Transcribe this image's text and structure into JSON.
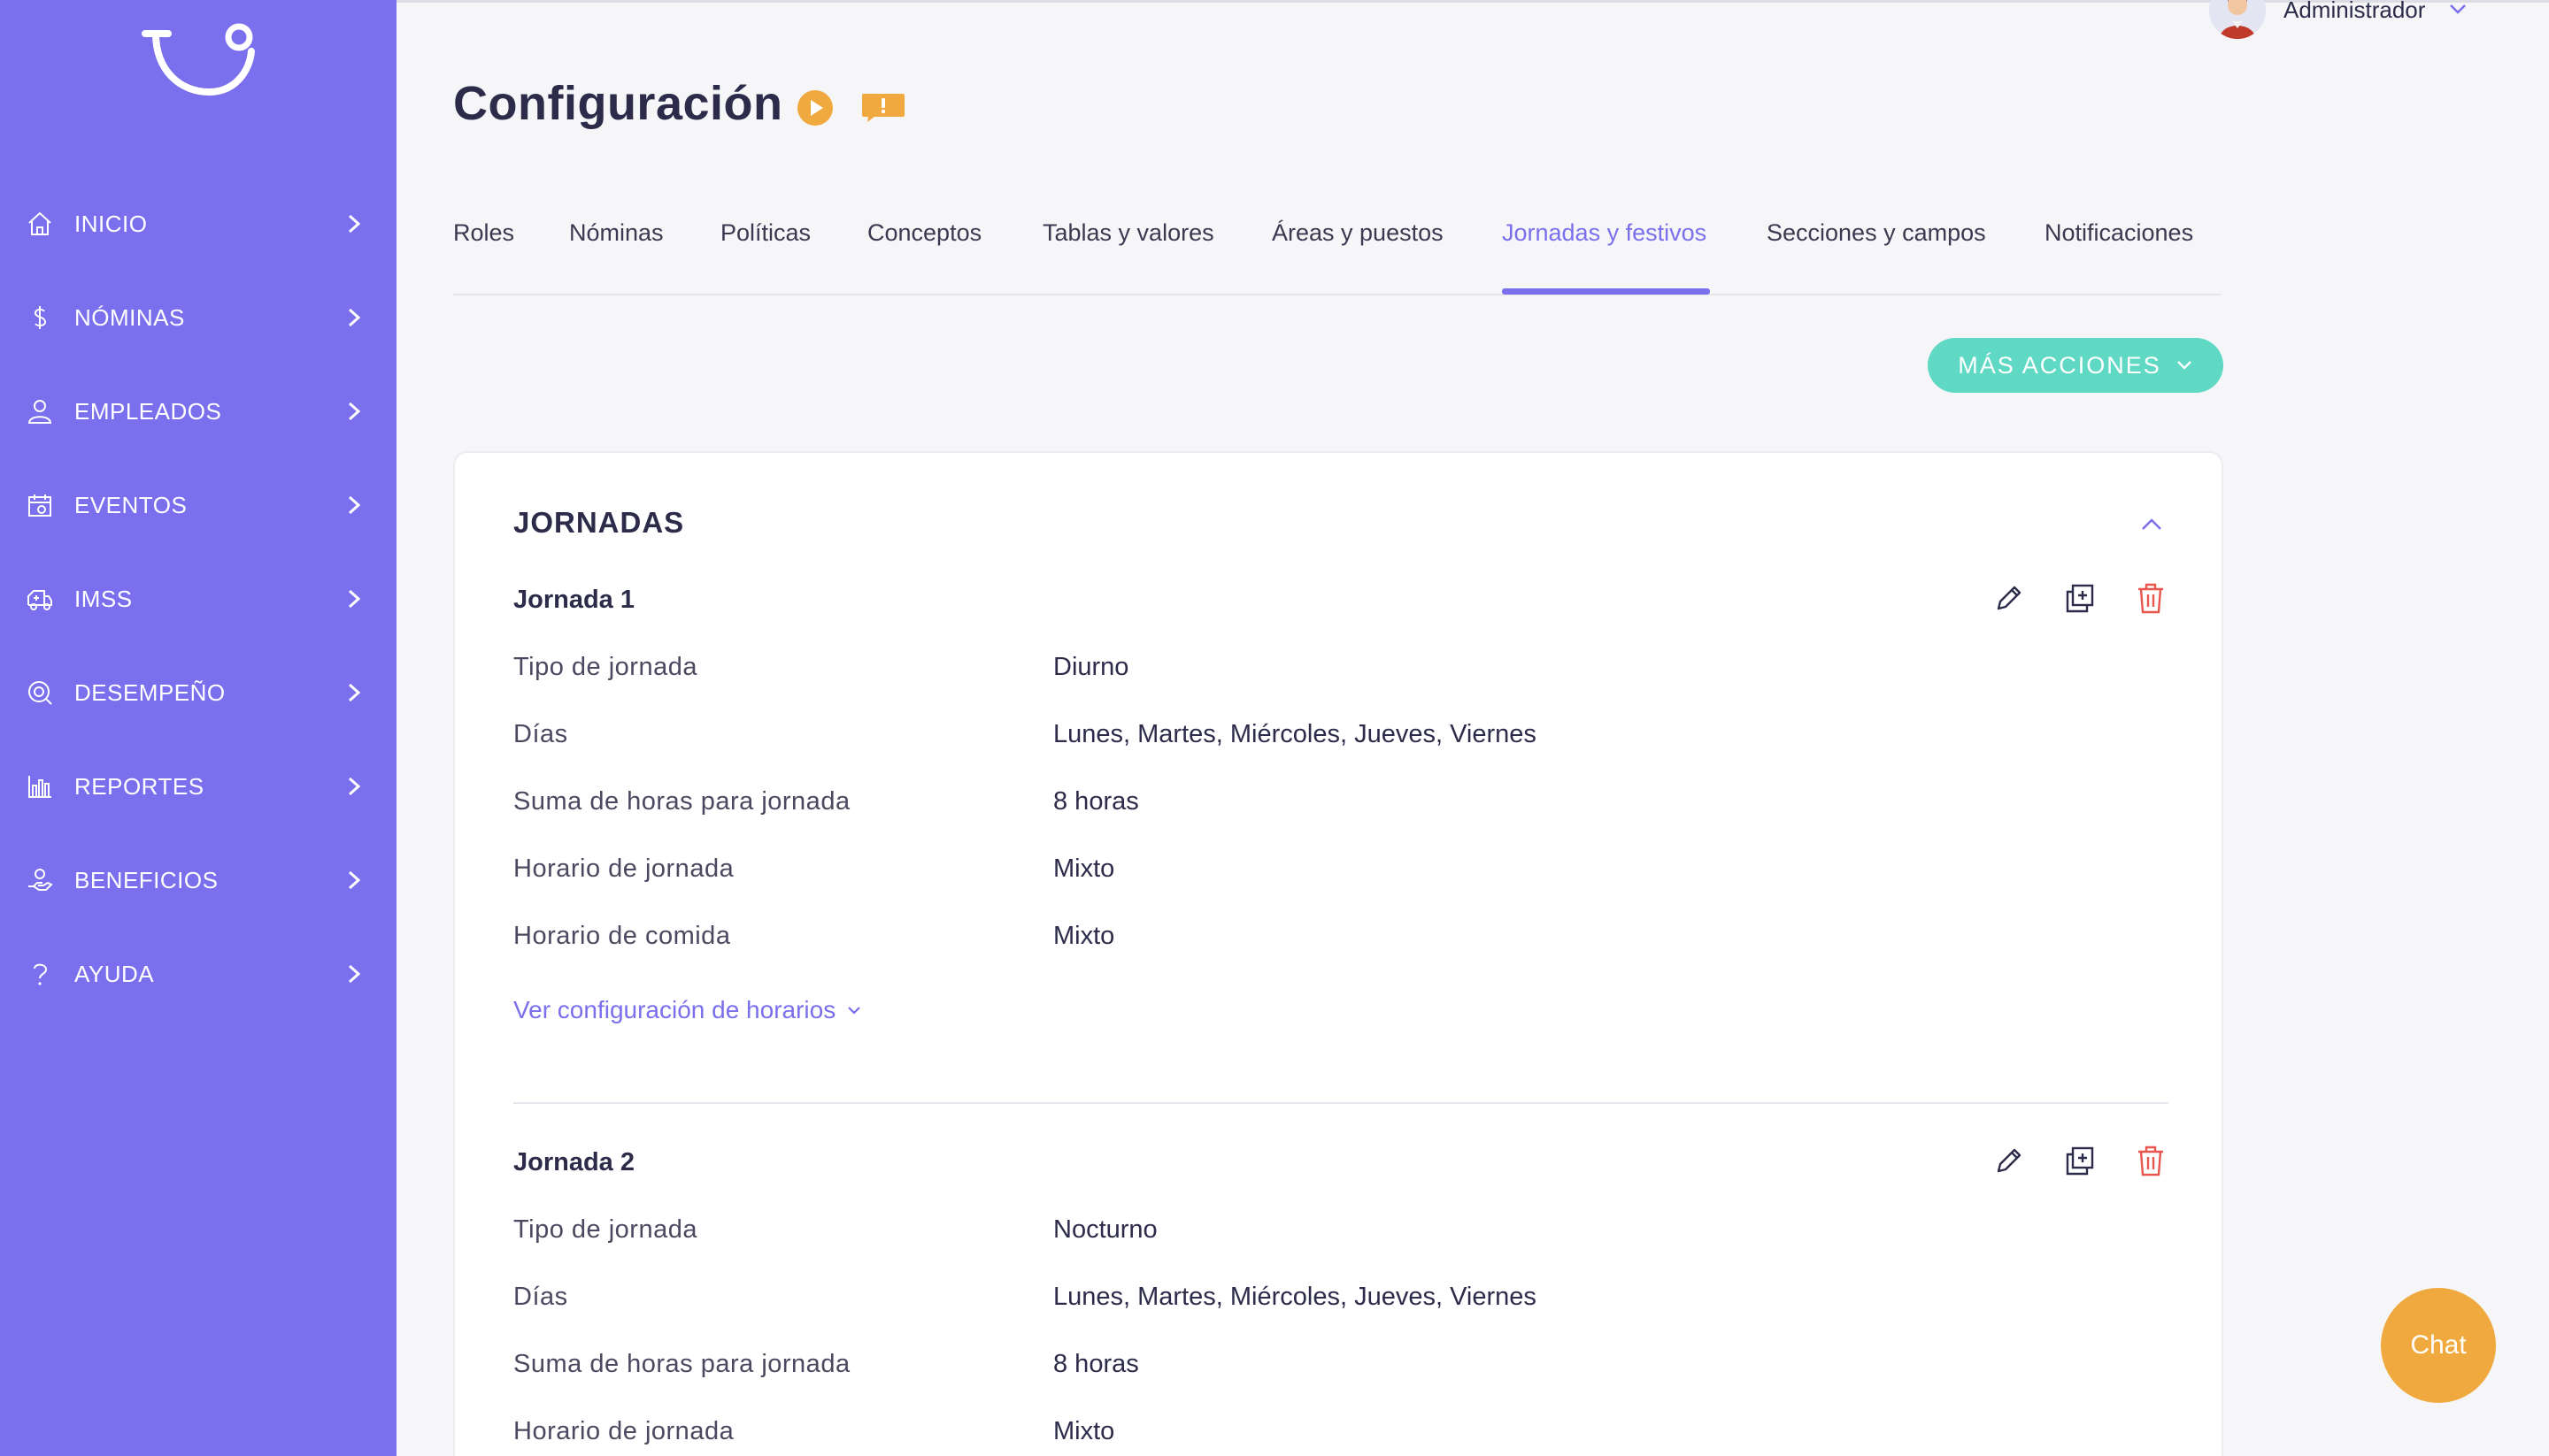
{
  "sidebar": {
    "logo_icon": "brand-logo-icon",
    "items": [
      {
        "label": "INICIO",
        "icon": "home-icon"
      },
      {
        "label": "NÓMINAS",
        "icon": "dollar-icon"
      },
      {
        "label": "EMPLEADOS",
        "icon": "user-icon"
      },
      {
        "label": "EVENTOS",
        "icon": "calendar-icon"
      },
      {
        "label": "IMSS",
        "icon": "ambulance-icon"
      },
      {
        "label": "DESEMPEÑO",
        "icon": "target-icon"
      },
      {
        "label": "REPORTES",
        "icon": "bar-chart-icon"
      },
      {
        "label": "BENEFICIOS",
        "icon": "hand-gift-icon"
      },
      {
        "label": "AYUDA",
        "icon": "question-icon"
      }
    ]
  },
  "header": {
    "user_name": "Administrador",
    "title": "Configuración"
  },
  "tabs": [
    {
      "label": "Roles",
      "active": false
    },
    {
      "label": "Nóminas",
      "active": false
    },
    {
      "label": "Políticas",
      "active": false
    },
    {
      "label": "Conceptos",
      "active": false
    },
    {
      "label": "Tablas y valores",
      "active": false
    },
    {
      "label": "Áreas y puestos",
      "active": false
    },
    {
      "label": "Jornadas y festivos",
      "active": true
    },
    {
      "label": "Secciones y campos",
      "active": false
    },
    {
      "label": "Notificaciones",
      "active": false
    }
  ],
  "actions": {
    "more_label": "MÁS ACCIONES"
  },
  "card": {
    "title": "JORNADAS",
    "jornadas": [
      {
        "title": "Jornada 1",
        "rows": [
          {
            "label": "Tipo de jornada",
            "value": "Diurno"
          },
          {
            "label": "Días",
            "value": "Lunes, Martes, Miércoles, Jueves, Viernes"
          },
          {
            "label": "Suma de horas para jornada",
            "value": "8 horas"
          },
          {
            "label": "Horario de jornada",
            "value": "Mixto"
          },
          {
            "label": "Horario de comida",
            "value": "Mixto"
          }
        ],
        "link": "Ver configuración de horarios"
      },
      {
        "title": "Jornada 2",
        "rows": [
          {
            "label": "Tipo de jornada",
            "value": "Nocturno"
          },
          {
            "label": "Días",
            "value": "Lunes, Martes, Miércoles, Jueves, Viernes"
          },
          {
            "label": "Suma de horas para jornada",
            "value": "8 horas"
          },
          {
            "label": "Horario de jornada",
            "value": "Mixto"
          }
        ]
      }
    ]
  },
  "chat": {
    "label": "Chat"
  },
  "colors": {
    "sidebar": "#7a6fec",
    "accent": "#7a6fec",
    "teal_button": "#5fd9c4",
    "chat": "#f0a93e",
    "delete": "#e8564e"
  }
}
